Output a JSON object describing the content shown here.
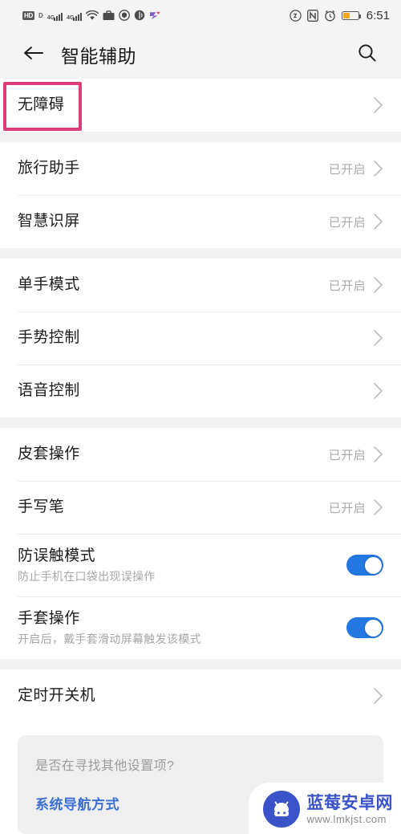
{
  "statusbar": {
    "icons_left": [
      "hd-icon",
      "volte-icon",
      "signal-4g-icon-1",
      "signal-4g-icon-2",
      "wifi-icon",
      "briefcase-icon",
      "shield-icon",
      "sound-icon",
      "app-icon"
    ],
    "hd_label": "HD",
    "volte_label": "D",
    "net_label_1": "4G",
    "net_label_2": "4G",
    "icons_right": [
      "do-not-disturb-icon",
      "nfc-icon",
      "alarm-icon",
      "battery-icon"
    ],
    "battery_level": "40",
    "clock": "6:51"
  },
  "header": {
    "back_icon": "back-arrow-icon",
    "title": "智能辅助",
    "search_icon": "search-icon"
  },
  "sections": [
    {
      "rows": [
        {
          "title": "无障碍",
          "value": "",
          "type": "chevron",
          "highlighted": true
        }
      ]
    },
    {
      "rows": [
        {
          "title": "旅行助手",
          "value": "已开启",
          "type": "chevron"
        },
        {
          "title": "智慧识屏",
          "value": "已开启",
          "type": "chevron"
        }
      ]
    },
    {
      "rows": [
        {
          "title": "单手模式",
          "value": "已开启",
          "type": "chevron"
        },
        {
          "title": "手势控制",
          "value": "",
          "type": "chevron"
        },
        {
          "title": "语音控制",
          "value": "",
          "type": "chevron"
        }
      ]
    },
    {
      "rows": [
        {
          "title": "皮套操作",
          "value": "已开启",
          "type": "chevron"
        },
        {
          "title": "手写笔",
          "value": "已开启",
          "type": "chevron"
        },
        {
          "title": "防误触模式",
          "subtitle": "防止手机在口袋出现误操作",
          "type": "toggle",
          "toggle_on": true
        },
        {
          "title": "手套操作",
          "subtitle": "开启后，戴手套滑动屏幕触发该模式",
          "type": "toggle",
          "toggle_on": true
        }
      ]
    },
    {
      "rows": [
        {
          "title": "定时开关机",
          "value": "",
          "type": "chevron"
        }
      ]
    }
  ],
  "footer": {
    "question": "是否在寻找其他设置项?",
    "link": "系统导航方式"
  },
  "watermark": {
    "logo_icon": "android-robot-icon",
    "title": "蓝莓安卓网",
    "url": "www.lmkjst.com"
  },
  "colors": {
    "accent_blue": "#2277e0",
    "highlight_pink": "#d93d7a",
    "link_blue": "#3b6fd4",
    "battery_orange": "#f5a623",
    "watermark_blue": "#3a53c8"
  }
}
